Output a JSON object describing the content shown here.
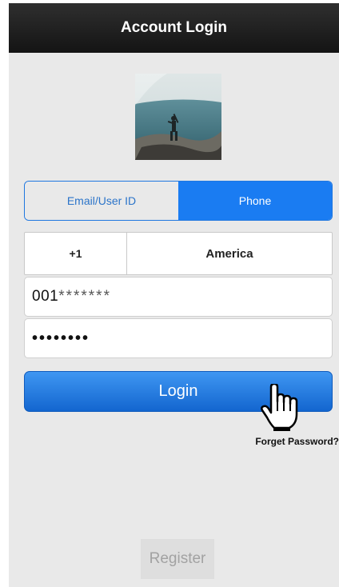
{
  "header": {
    "title": "Account Login"
  },
  "login_mode": {
    "tabs": [
      {
        "label": "Email/User ID",
        "selected": false
      },
      {
        "label": "Phone",
        "selected": true
      }
    ]
  },
  "country": {
    "code": "+1",
    "name": "America"
  },
  "phone_field": {
    "prefix": "001",
    "masked": "*******"
  },
  "password_field": {
    "value": "••••••••"
  },
  "buttons": {
    "login": "Login",
    "forget_password": "Forget Password?",
    "register": "Register"
  },
  "colors": {
    "accent": "#1a7cf2",
    "titlebar": "#1c1c1c",
    "background": "#e9e9e9"
  },
  "icons": {
    "cursor": "hand-pointer-icon",
    "profile": "avatar-photo"
  }
}
